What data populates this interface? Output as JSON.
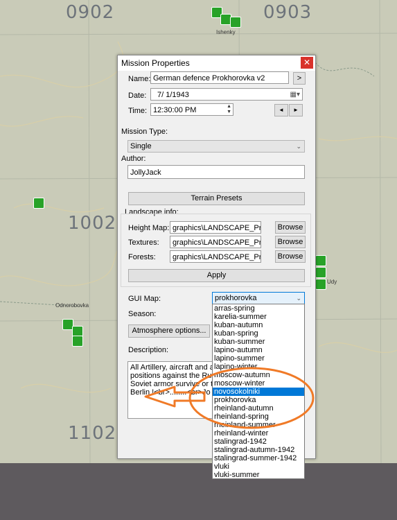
{
  "map": {
    "grid_labels": [
      "0902",
      "0903",
      "1002",
      "1102"
    ],
    "towns": [
      "Ishenky",
      "Odnorobovka",
      "Udy"
    ]
  },
  "dialog": {
    "title": "Mission Properties",
    "close_icon": "close-icon",
    "name_label": "Name:",
    "name_value": "German defence Prokhorovka v2",
    "name_btn": ">",
    "date_label": "Date:",
    "date_value": "7/  1/1943",
    "time_label": "Time:",
    "time_value": "12:30:00 PM",
    "prev_btn": "◄",
    "next_btn": "►",
    "mission_type_label": "Mission Type:",
    "mission_type_value": "Single",
    "author_label": "Author:",
    "author_value": "JollyJack",
    "terrain_presets": "Terrain Presets",
    "landscape_label": "Landscape info:",
    "height_label": "Height Map:",
    "height_value": "graphics\\LANDSCAPE_Prokh",
    "textures_label": "Textures:",
    "textures_value": "graphics\\LANDSCAPE_Prokl",
    "forests_label": "Forests:",
    "forests_value": "graphics\\LANDSCAPE_Prokl",
    "browse": "Browse",
    "apply": "Apply",
    "gui_map_label": "GUI Map:",
    "gui_map_value": "prokhorovka",
    "season_label": "Season:",
    "atmosphere_btn": "Atmosphere options...",
    "description_label": "Description:",
    "description_lines": [
      "All Artillery, aircraft and a",
      "positions against the Russ",
      "Soviet armor survive or th",
      "Berlin !<br>........<br>Jo"
    ]
  },
  "gui_map_options": [
    "arras-spring",
    "karelia-summer",
    "kuban-autumn",
    "kuban-spring",
    "kuban-summer",
    "lapino-autumn",
    "lapino-summer",
    "lapino-winter",
    "moscow-autumn",
    "moscow-winter",
    "novosokolniki",
    "prokhorovka",
    "rheinland-autumn",
    "rheinland-spring",
    "rheinland-summer",
    "rheinland-winter",
    "stalingrad-1942",
    "stalingrad-autumn-1942",
    "stalingrad-summer-1942",
    "vluki",
    "vluki-summer"
  ],
  "selected_option": "novosokolniki",
  "colors": {
    "annotation": "#f07a27",
    "selection": "#0078d7",
    "close": "#d9322b"
  }
}
